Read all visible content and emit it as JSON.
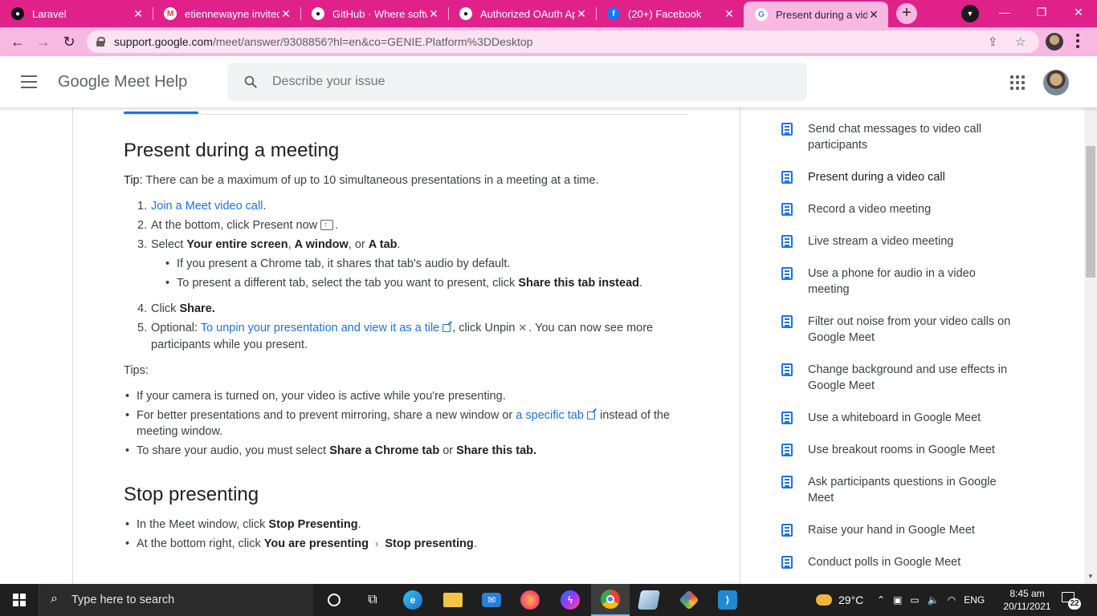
{
  "browser": {
    "tabs": [
      {
        "title": "Laravel",
        "favicon": "github-icon"
      },
      {
        "title": "etiennewayne invited y",
        "favicon": "gmail-icon"
      },
      {
        "title": "GitHub · Where softwa",
        "favicon": "github-icon"
      },
      {
        "title": "Authorized OAuth App",
        "favicon": "github-icon"
      },
      {
        "title": "(20+) Facebook",
        "favicon": "facebook-icon"
      },
      {
        "title": "Present during a video",
        "favicon": "google-icon"
      }
    ],
    "url_host": "support.google.com",
    "url_rest": "/meet/answer/9308856?hl=en&co=GENIE.Platform%3DDesktop",
    "accent": "#e0218a"
  },
  "header": {
    "title": "Google Meet Help",
    "search_placeholder": "Describe your issue"
  },
  "article": {
    "section1_title": "Present during a meeting",
    "tip_label": "Tip:",
    "tip_text": " There can be a maximum of up to 10 simultaneous presentations in a meeting at a time.",
    "steps": {
      "n1": "1.",
      "s1_link": "Join a Meet video call",
      "s1_end": ".",
      "n2": "2.",
      "s2_text": "At the bottom, click Present now",
      "s2_end": ".",
      "n3": "3.",
      "s3_pre": "Select ",
      "s3_b1": "Your entire screen",
      "s3_c1": ", ",
      "s3_b2": "A window",
      "s3_c2": ", or ",
      "s3_b3": "A tab",
      "s3_end": ".",
      "sub1": "If you present a Chrome tab, it shares that tab's audio by default.",
      "sub2_pre": "To present a different tab, select the tab you want to present, click ",
      "sub2_b": "Share this tab instead",
      "sub2_end": ".",
      "n4": "4.",
      "s4_pre": "Click ",
      "s4_b": "Share.",
      "n5": "5.",
      "s5_pre": "Optional: ",
      "s5_link": "To unpin your presentation and view it as a tile",
      "s5_mid": ", click Unpin",
      "s5_end": ". You can now see more",
      "s5_line2": "participants while you present."
    },
    "tips_label": "Tips:",
    "tips": {
      "t1": "If your camera is turned on, your video is active while you're presenting.",
      "t2_pre": "For better presentations and to prevent mirroring, share a new window or ",
      "t2_link": "a specific tab",
      "t2_end": " instead of the",
      "t2_line2": "meeting window.",
      "t3_pre": "To share your audio, you must select ",
      "t3_b1": "Share a Chrome tab",
      "t3_mid": " or ",
      "t3_b2": "Share this tab."
    },
    "section2_title": "Stop presenting",
    "stop": {
      "l1_pre": "In the Meet window, click ",
      "l1_b": "Stop Presenting",
      "l1_end": ".",
      "l2_pre": "At the bottom right, click ",
      "l2_b1": "You are presenting",
      "l2_b2": "Stop presenting",
      "l2_end": "."
    }
  },
  "sidebar": {
    "items": [
      {
        "label": "Send chat messages to video call participants"
      },
      {
        "label": "Present during a video call"
      },
      {
        "label": "Record a video meeting"
      },
      {
        "label": "Live stream a video meeting"
      },
      {
        "label": "Use a phone for audio in a video meeting"
      },
      {
        "label": "Filter out noise from your video calls on Google Meet"
      },
      {
        "label": "Change background and use effects in Google Meet"
      },
      {
        "label": "Use a whiteboard in Google Meet"
      },
      {
        "label": "Use breakout rooms in Google Meet"
      },
      {
        "label": "Ask participants questions in Google Meet"
      },
      {
        "label": "Raise your hand in Google Meet"
      },
      {
        "label": "Conduct polls in Google Meet"
      }
    ]
  },
  "taskbar": {
    "search_text": "Type here to search",
    "weather": "29°C",
    "language": "ENG",
    "time": "8:45 am",
    "date": "20/11/2021",
    "notifications": "22"
  }
}
